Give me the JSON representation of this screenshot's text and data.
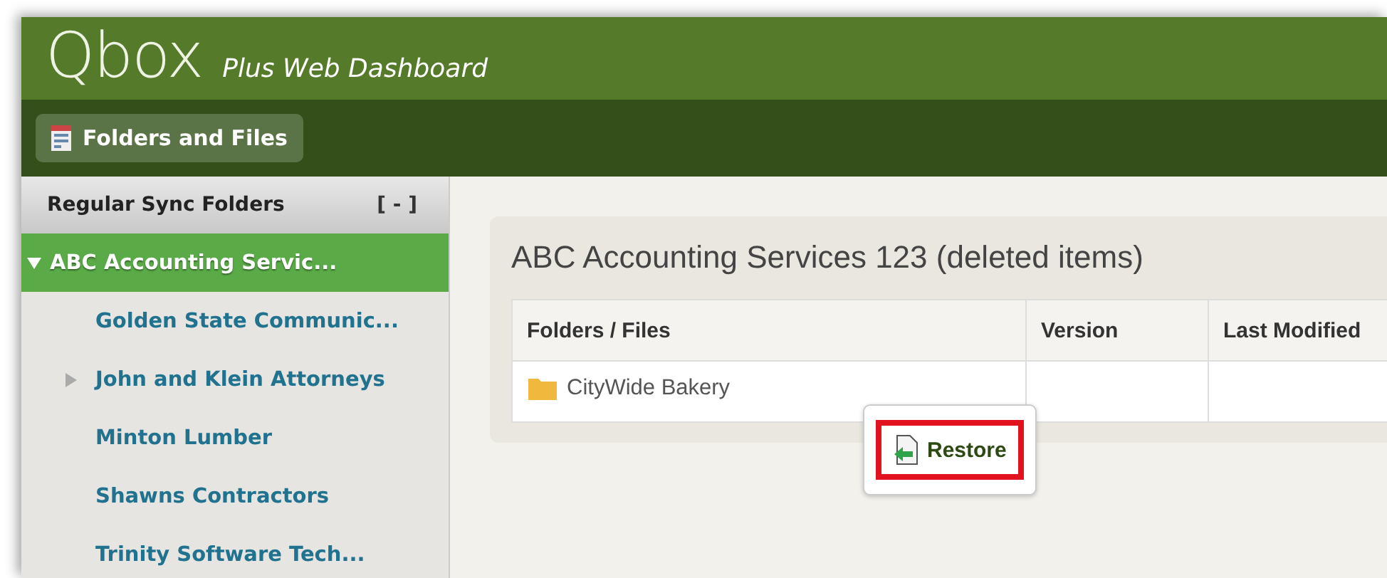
{
  "header": {
    "logo": "Qbox",
    "subtitle": "Plus Web Dashboard"
  },
  "toolbar": {
    "button": "Folders and Files"
  },
  "sidebar": {
    "title": "Regular Sync Folders",
    "collapse": "[ - ]",
    "items": [
      {
        "label": "ABC Accounting Servic...",
        "selected": true,
        "expandable": true,
        "expanded": true,
        "children": [
          {
            "label": "Golden State Communic...",
            "selected": false,
            "expandable": false,
            "expanded": false
          },
          {
            "label": "John and Klein Attorneys",
            "selected": false,
            "expandable": true,
            "expanded": false
          },
          {
            "label": "Minton Lumber",
            "selected": false,
            "expandable": false,
            "expanded": false
          },
          {
            "label": "Shawns Contractors",
            "selected": false,
            "expandable": false,
            "expanded": false
          },
          {
            "label": "Trinity Software Tech...",
            "selected": false,
            "expandable": false,
            "expanded": false
          }
        ]
      }
    ]
  },
  "panel": {
    "title": "ABC Accounting Services 123 (deleted items)",
    "table": {
      "columns": [
        "Folders / Files",
        "Version",
        "Last Modified"
      ],
      "rows": [
        {
          "kind": "folder",
          "name": "CityWide Bakery"
        }
      ]
    },
    "context_menu": {
      "items": [
        {
          "label": "Restore",
          "highlighted": true
        }
      ]
    }
  }
}
